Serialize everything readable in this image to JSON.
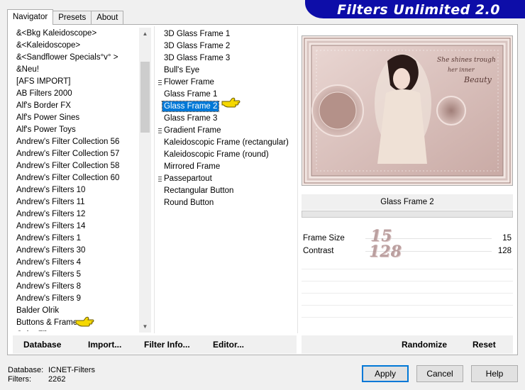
{
  "window": {
    "title": "Filters Unlimited 2.0"
  },
  "tabs": [
    {
      "label": "Navigator",
      "active": true
    },
    {
      "label": "Presets",
      "active": false
    },
    {
      "label": "About",
      "active": false
    }
  ],
  "categories": [
    "&<Bkg Kaleidoscope>",
    "&<Kaleidoscope>",
    "&<Sandflower Specials°v° >",
    "&Neu!",
    "[AFS IMPORT]",
    "AB Filters 2000",
    "Alf's Border FX",
    "Alf's Power Sines",
    "Alf's Power Toys",
    "Andrew's Filter Collection 56",
    "Andrew's Filter Collection 57",
    "Andrew's Filter Collection 58",
    "Andrew's Filter Collection 60",
    "Andrew's Filters 10",
    "Andrew's Filters 11",
    "Andrew's Filters 12",
    "Andrew's Filters 14",
    "Andrew's Filters 1",
    "Andrew's Filters 30",
    "Andrew's Filters 4",
    "Andrew's Filters 5",
    "Andrew's Filters 8",
    "Andrew's Filters 9",
    "Balder Olrik",
    "Buttons & Frames",
    "Color Filters"
  ],
  "filters": [
    {
      "label": "3D Glass Frame 1",
      "group": false
    },
    {
      "label": "3D Glass Frame 2",
      "group": false
    },
    {
      "label": "3D Glass Frame 3",
      "group": false
    },
    {
      "label": "Bull's Eye",
      "group": false
    },
    {
      "label": "Flower Frame",
      "group": true
    },
    {
      "label": "Glass Frame 1",
      "group": false
    },
    {
      "label": "Glass Frame 2",
      "group": false,
      "selected": true
    },
    {
      "label": "Glass Frame 3",
      "group": false
    },
    {
      "label": "Gradient Frame",
      "group": true
    },
    {
      "label": "Kaleidoscopic Frame (rectangular)",
      "group": false
    },
    {
      "label": "Kaleidoscopic Frame (round)",
      "group": false
    },
    {
      "label": "Mirrored Frame",
      "group": false
    },
    {
      "label": "Passepartout",
      "group": true
    },
    {
      "label": "Rectangular Button",
      "group": false
    },
    {
      "label": "Round Button",
      "group": false
    }
  ],
  "selected_filter": "Glass Frame 2",
  "params": [
    {
      "name": "Frame Size",
      "value": "15"
    },
    {
      "name": "Contrast",
      "value": "128"
    }
  ],
  "preview": {
    "script_text": [
      "She shines trough",
      "her inner",
      "Beauty"
    ]
  },
  "left_toolbar": {
    "database": "Database",
    "import": "Import...",
    "filter_info": "Filter Info...",
    "editor": "Editor..."
  },
  "right_toolbar": {
    "randomize": "Randomize",
    "reset": "Reset"
  },
  "status": {
    "database_label": "Database:",
    "database_value": "ICNET-Filters",
    "filters_label": "Filters:",
    "filters_value": "2262"
  },
  "buttons": {
    "apply": "Apply",
    "cancel": "Cancel",
    "help": "Help"
  },
  "colors": {
    "banner": "#0d0da8",
    "selection": "#0078d7",
    "pointer_hand": "#f5d800"
  },
  "icons": [
    "pointer-hand-icon",
    "scroll-up-arrow-icon",
    "scroll-down-arrow-icon",
    "group-marker-icon"
  ]
}
